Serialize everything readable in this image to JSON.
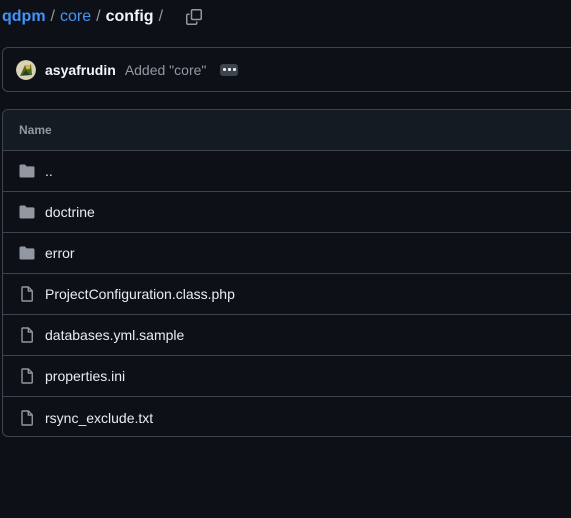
{
  "breadcrumb": {
    "root": "qdpm",
    "sep1": "/",
    "parent": "core",
    "sep2": "/",
    "current": "config",
    "sep3": "/"
  },
  "commit": {
    "author": "asyafrudin",
    "message": "Added \"core\""
  },
  "file_table": {
    "header": "Name",
    "rows": [
      {
        "name": "..",
        "type": "directory",
        "icon": "folder-icon"
      },
      {
        "name": "doctrine",
        "type": "directory",
        "icon": "folder-icon"
      },
      {
        "name": "error",
        "type": "directory",
        "icon": "folder-icon"
      },
      {
        "name": "ProjectConfiguration.class.php",
        "type": "file",
        "icon": "file-icon"
      },
      {
        "name": "databases.yml.sample",
        "type": "file",
        "icon": "file-icon"
      },
      {
        "name": "properties.ini",
        "type": "file",
        "icon": "file-icon"
      },
      {
        "name": "rsync_exclude.txt",
        "type": "file",
        "icon": "file-icon"
      }
    ]
  },
  "colors": {
    "background": "#0d1117",
    "link": "#4493f8",
    "border": "#3d444d",
    "muted_text": "#9198a1"
  }
}
